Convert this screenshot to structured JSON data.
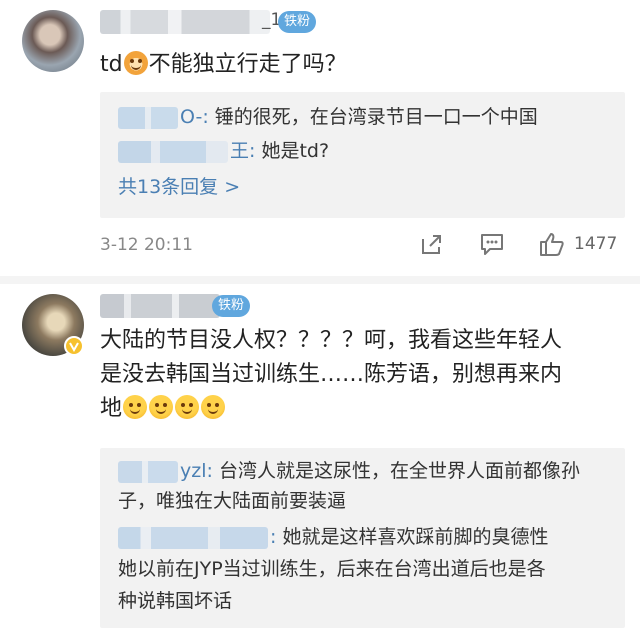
{
  "comments": [
    {
      "username_suffix": "_1",
      "badge": "铁粉",
      "text_prefix": "td",
      "text_suffix": "不能独立行走了吗？",
      "replies": [
        {
          "name_suffix": "O-:",
          "text": " 锤的很死，在台湾录节目一口一个中国"
        },
        {
          "name_suffix": "王:",
          "text": " 她是td?"
        }
      ],
      "more_replies": "共13条回复 >",
      "timestamp": "3-12 20:11",
      "likes": "1477"
    },
    {
      "badge": "铁粉",
      "text_line_1": "大陆的节目没人权？？？？呵，我看这些年轻人",
      "text_line_2": "是没去韩国当过训练生……陈芳语，别想再来内",
      "text_line_3": "地",
      "replies": [
        {
          "name_suffix": "yzl:",
          "text_1": " 台湾人就是这尿性，在全世界人面前都像孙",
          "text_2": "子，唯独在大陆面前要装逼"
        },
        {
          "name_suffix": ":",
          "text_1": " 她就是这样喜欢踩前脚的臭德性",
          "text_2": "她以前在JYP当过训练生，后来在台湾出道后也是各",
          "text_3": "种说韩国坏话"
        }
      ]
    }
  ],
  "icons": {
    "share": "share-icon",
    "comment": "comment-icon",
    "like": "thumbs-up-icon",
    "verified": "verified-v-icon",
    "emoji_dog": "dog-emoji-icon",
    "emoji_angry": "pouting-emoji-icon"
  },
  "colors": {
    "link_blue": "#4a7fb3",
    "badge_blue": "#60a7de",
    "reply_bg": "#f2f2f2",
    "verified_yellow": "#f6c12e"
  }
}
